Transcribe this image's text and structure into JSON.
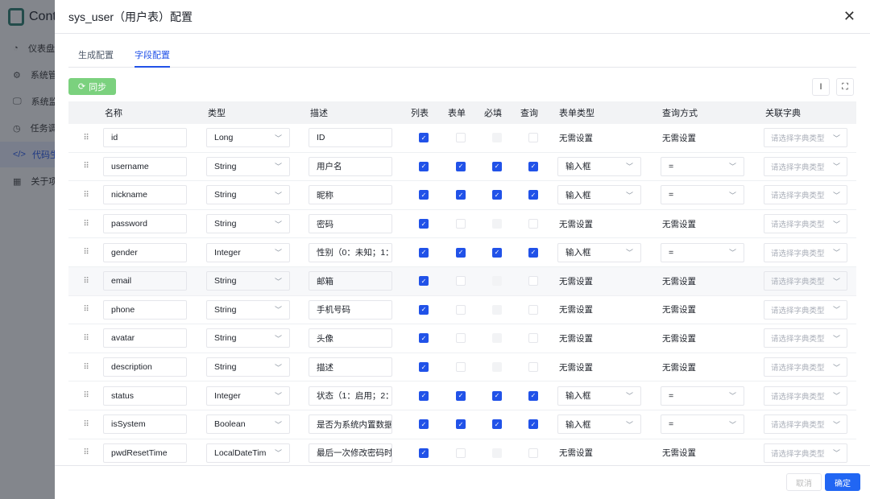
{
  "app": {
    "logo_text": "Cont",
    "nav": [
      {
        "label": "仪表盘",
        "icon": "dashboard-icon",
        "glyph": "◔",
        "active": false
      },
      {
        "label": "系统管理",
        "icon": "settings-icon",
        "glyph": "⚙",
        "active": false
      },
      {
        "label": "系统监控",
        "icon": "monitor-icon",
        "glyph": "🖵",
        "active": false
      },
      {
        "label": "任务调度",
        "icon": "clock-icon",
        "glyph": "◷",
        "active": false
      },
      {
        "label": "代码生成",
        "icon": "code-icon",
        "glyph": "</>",
        "active": true
      },
      {
        "label": "关于项目",
        "icon": "grid-icon",
        "glyph": "▦",
        "active": false
      }
    ]
  },
  "drawer": {
    "title": "sys_user（用户表）配置",
    "close_glyph": "✕",
    "tabs": [
      {
        "label": "生成配置",
        "active": false
      },
      {
        "label": "字段配置",
        "active": true
      }
    ],
    "sync_label": "同步",
    "sync_glyph": "⟳",
    "tool_text_glyph": "I",
    "tool_fullscreen_glyph": "⛶",
    "footer": {
      "cancel_label": "取消",
      "ok_label": "确定"
    }
  },
  "table": {
    "columns": [
      "",
      "名称",
      "类型",
      "描述",
      "列表",
      "表单",
      "必填",
      "查询",
      "表单类型",
      "查询方式",
      "关联字典"
    ],
    "dict_placeholder": "请选择字典类型",
    "no_setting": "无需设置",
    "rows": [
      {
        "name": "id",
        "type": "Long",
        "desc": "ID",
        "list": true,
        "form": false,
        "required": null,
        "query": false,
        "form_type": null,
        "query_type": null
      },
      {
        "name": "username",
        "type": "String",
        "desc": "用户名",
        "list": true,
        "form": true,
        "required": true,
        "query": true,
        "form_type": "输入框",
        "query_type": "="
      },
      {
        "name": "nickname",
        "type": "String",
        "desc": "昵称",
        "list": true,
        "form": true,
        "required": true,
        "query": true,
        "form_type": "输入框",
        "query_type": "="
      },
      {
        "name": "password",
        "type": "String",
        "desc": "密码",
        "list": true,
        "form": false,
        "required": null,
        "query": false,
        "form_type": null,
        "query_type": null
      },
      {
        "name": "gender",
        "type": "Integer",
        "desc": "性别（0：未知；1：",
        "list": true,
        "form": true,
        "required": true,
        "query": true,
        "form_type": "输入框",
        "query_type": "="
      },
      {
        "name": "email",
        "type": "String",
        "desc": "邮箱",
        "list": true,
        "form": false,
        "required": null,
        "query": false,
        "form_type": null,
        "query_type": null,
        "highlight": true
      },
      {
        "name": "phone",
        "type": "String",
        "desc": "手机号码",
        "list": true,
        "form": false,
        "required": null,
        "query": false,
        "form_type": null,
        "query_type": null
      },
      {
        "name": "avatar",
        "type": "String",
        "desc": "头像",
        "list": true,
        "form": false,
        "required": null,
        "query": false,
        "form_type": null,
        "query_type": null
      },
      {
        "name": "description",
        "type": "String",
        "desc": "描述",
        "list": true,
        "form": false,
        "required": null,
        "query": false,
        "form_type": null,
        "query_type": null
      },
      {
        "name": "status",
        "type": "Integer",
        "desc": "状态（1：启用；2：",
        "list": true,
        "form": true,
        "required": true,
        "query": true,
        "form_type": "输入框",
        "query_type": "="
      },
      {
        "name": "isSystem",
        "type": "Boolean",
        "desc": "是否为系统内置数据",
        "list": true,
        "form": true,
        "required": true,
        "query": true,
        "form_type": "输入框",
        "query_type": "="
      },
      {
        "name": "pwdResetTime",
        "type": "LocalDateTim",
        "desc": "最后一次修改密码时",
        "list": true,
        "form": false,
        "required": null,
        "query": false,
        "form_type": null,
        "query_type": null
      }
    ]
  }
}
